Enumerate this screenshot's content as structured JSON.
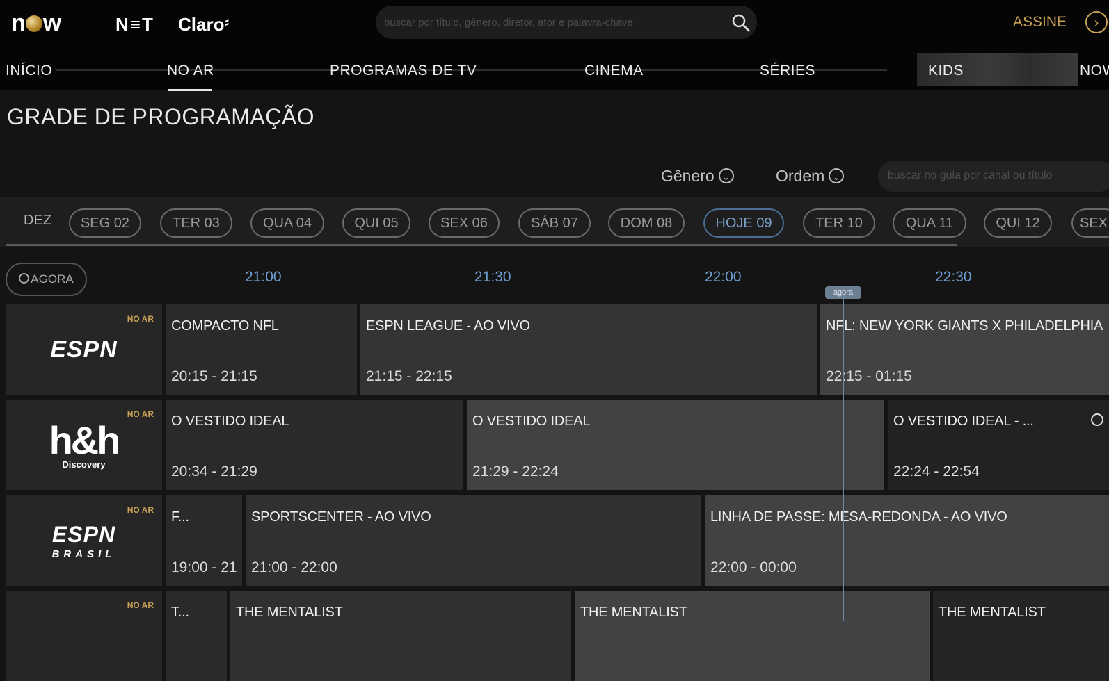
{
  "brand": {
    "now": "now",
    "net": "N≡T",
    "claro": "Claro"
  },
  "search": {
    "placeholder": "buscar por título, gênero, diretor, ator e palavra-chave"
  },
  "header": {
    "assine": "ASSINE"
  },
  "nav": {
    "items": [
      "INÍCIO",
      "NO AR",
      "PROGRAMAS DE TV",
      "CINEMA",
      "SÉRIES",
      "KIDS",
      "NOW"
    ],
    "active": "NO AR"
  },
  "page_title": "GRADE DE PROGRAMAÇÃO",
  "filters": {
    "genero": "Gênero",
    "ordem": "Ordem",
    "guide_placeholder": "buscar no guia por canal ou título"
  },
  "days": {
    "month": "DEZ",
    "items": [
      "SEG 02",
      "TER 03",
      "QUA 04",
      "QUI 05",
      "SEX 06",
      "SÁB 07",
      "DOM 08",
      "HOJE 09",
      "TER 10",
      "QUA 11",
      "QUI 12",
      "SEX"
    ],
    "selected": "HOJE 09"
  },
  "timeline": {
    "agora_button": "AGORA",
    "times": [
      "21:00",
      "21:30",
      "22:00",
      "22:30"
    ],
    "now_marker": "agora"
  },
  "channels": [
    {
      "logo": "ESPN",
      "sub": "",
      "badge": "NO AR",
      "programs": [
        {
          "title": "COMPACTO NFL",
          "time": "20:15 - 21:15"
        },
        {
          "title": "ESPN LEAGUE - AO VIVO",
          "time": "21:15 - 22:15"
        },
        {
          "title": "NFL: NEW YORK GIANTS X PHILADELPHIA",
          "time": "22:15 - 01:15"
        }
      ]
    },
    {
      "logo": "h&h",
      "sub": "Discovery",
      "badge": "NO AR",
      "programs": [
        {
          "title": "O VESTIDO IDEAL",
          "time": "20:34 - 21:29"
        },
        {
          "title": "O VESTIDO IDEAL",
          "time": "21:29 - 22:24"
        },
        {
          "title": "O VESTIDO IDEAL - ...",
          "time": "22:24 - 22:54"
        }
      ]
    },
    {
      "logo": "ESPN",
      "sub": "BRASIL",
      "badge": "NO AR",
      "programs": [
        {
          "title": "F...",
          "time": "19:00 - 21"
        },
        {
          "title": "SPORTSCENTER - AO VIVO",
          "time": "21:00 - 22:00"
        },
        {
          "title": "LINHA DE PASSE: MESA-REDONDA - AO VIVO",
          "time": "22:00 - 00:00"
        }
      ]
    },
    {
      "logo": "",
      "sub": "",
      "badge": "NO AR",
      "programs": [
        {
          "title": "T...",
          "time": ""
        },
        {
          "title": "THE MENTALIST",
          "time": ""
        },
        {
          "title": "THE MENTALIST",
          "time": ""
        },
        {
          "title": "THE MENTALIST",
          "time": ""
        }
      ]
    }
  ],
  "colors": {
    "accent_gold": "#c9a155",
    "time_blue": "#6f9fd2",
    "today_border": "#4a6e95"
  }
}
